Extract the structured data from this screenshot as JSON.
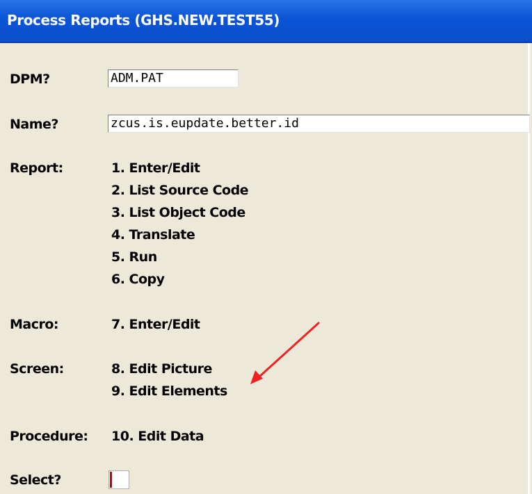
{
  "window": {
    "title": "Process Reports (GHS.NEW.TEST55)"
  },
  "form": {
    "dpm": {
      "label": "DPM?",
      "value": "ADM.PAT"
    },
    "name": {
      "label": "Name?",
      "value": "zcus.is.eupdate.better.id"
    },
    "report": {
      "label": "Report:",
      "items": [
        "1. Enter/Edit",
        "2. List Source Code",
        "3. List Object Code",
        "4. Translate",
        "5. Run",
        "6. Copy"
      ]
    },
    "macro": {
      "label": "Macro:",
      "items": [
        "7. Enter/Edit"
      ]
    },
    "screen": {
      "label": "Screen:",
      "items": [
        "8. Edit Picture",
        "9. Edit Elements"
      ]
    },
    "procedure": {
      "label": "Procedure:",
      "items": [
        "10. Edit Data"
      ]
    },
    "select": {
      "label": "Select?",
      "value": ""
    }
  },
  "colors": {
    "titlebar": "#0b4fc9",
    "background": "#ece9d8",
    "annotation_arrow": "#ee2222"
  }
}
